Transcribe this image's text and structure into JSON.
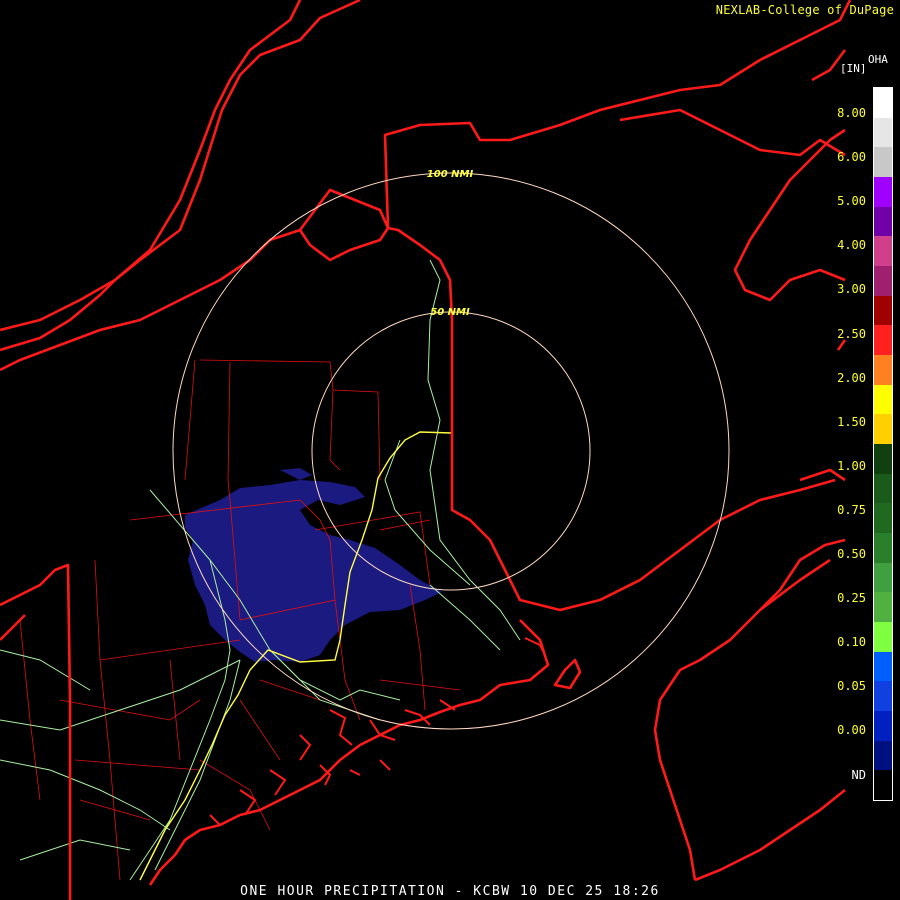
{
  "header": {
    "credit": "NEXLAB-College of DuPage"
  },
  "footer": {
    "title": "ONE HOUR PRECIPITATION - KCBW 10 DEC 25 18:26"
  },
  "legend": {
    "unit": "[IN]",
    "product": "OHA",
    "labels": [
      "8.00",
      "6.00",
      "5.00",
      "4.00",
      "3.00",
      "2.50",
      "2.00",
      "1.50",
      "1.00",
      "0.75",
      "0.50",
      "0.25",
      "0.10",
      "0.05",
      "0.00",
      "ND"
    ],
    "colors": [
      "#ffffff",
      "#e6e6e6",
      "#c8c8c8",
      "#a000ff",
      "#7000a8",
      "#d0408a",
      "#a02070",
      "#a00000",
      "#ff2020",
      "#ff8020",
      "#ffff00",
      "#ffd000",
      "#104010",
      "#1a5a1a",
      "#206a20",
      "#2a802a",
      "#40a040",
      "#50b040",
      "#80ff40",
      "#0060ff",
      "#1040e0",
      "#0020c0",
      "#001080",
      "#000000"
    ]
  },
  "map": {
    "range_rings": [
      "100 NMI",
      "50 NMI"
    ],
    "colors": {
      "borders": "#ff1a1a",
      "counties": "#e01010",
      "roads": "#a8f0a0",
      "highway": "#ffff40",
      "rings": "#ffd8c0",
      "precip": "#1a1a80"
    }
  }
}
